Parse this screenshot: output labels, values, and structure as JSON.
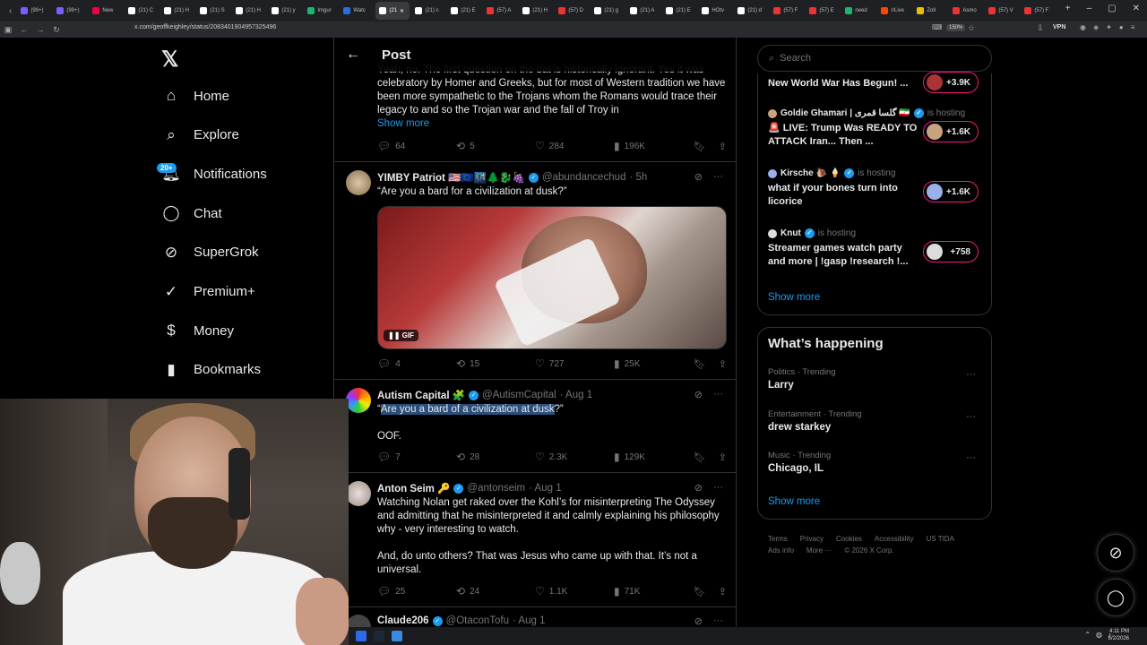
{
  "browser": {
    "tabs": [
      {
        "label": "(99+)",
        "color": "#7b5cff"
      },
      {
        "label": "(99+)",
        "color": "#7b5cff"
      },
      {
        "label": "New",
        "color": "#e04"
      },
      {
        "label": "(21) C",
        "color": "#fff"
      },
      {
        "label": "(21) H",
        "color": "#fff"
      },
      {
        "label": "(21) S",
        "color": "#fff"
      },
      {
        "label": "(21) H",
        "color": "#fff"
      },
      {
        "label": "(21) y",
        "color": "#fff"
      },
      {
        "label": "Imgur",
        "color": "#1bb76e"
      },
      {
        "label": "Watc",
        "color": "#2e6ae6"
      },
      {
        "label": "(21",
        "color": "#fff",
        "active": true
      },
      {
        "label": "(21) c",
        "color": "#fff"
      },
      {
        "label": "(21) E",
        "color": "#fff"
      },
      {
        "label": "(57) A",
        "color": "#e33"
      },
      {
        "label": "(21) H",
        "color": "#fff"
      },
      {
        "label": "(57) D",
        "color": "#e33"
      },
      {
        "label": "(21) g",
        "color": "#fff"
      },
      {
        "label": "(21) A",
        "color": "#fff"
      },
      {
        "label": "(21) E",
        "color": "#fff"
      },
      {
        "label": "HOtv",
        "color": "#fff"
      },
      {
        "label": "(21) d",
        "color": "#fff"
      },
      {
        "label": "(57) F",
        "color": "#e33"
      },
      {
        "label": "(57) E",
        "color": "#e33"
      },
      {
        "label": "need",
        "color": "#1bb76e"
      },
      {
        "label": "r/Live",
        "color": "#ff4500"
      },
      {
        "label": "Zoll",
        "color": "#e9c000"
      },
      {
        "label": "Asmo",
        "color": "#e33"
      },
      {
        "label": "(57) V",
        "color": "#e33"
      },
      {
        "label": "(57) F",
        "color": "#e33"
      }
    ],
    "url": "x.com/geoffkeighley/status/2083401904957325496",
    "zoom": "150%",
    "vpn": "VPN"
  },
  "sidebar": {
    "items": [
      {
        "label": "Home",
        "icon": "home-icon"
      },
      {
        "label": "Explore",
        "icon": "search-icon"
      },
      {
        "label": "Notifications",
        "icon": "bell-icon"
      },
      {
        "label": "Chat",
        "icon": "chat-icon"
      },
      {
        "label": "SuperGrok",
        "icon": "grok-icon"
      },
      {
        "label": "Premium+",
        "icon": "premium-icon"
      },
      {
        "label": "Money",
        "icon": "money-icon"
      },
      {
        "label": "Bookmarks",
        "icon": "bookmark-icon"
      }
    ],
    "notif_badge": "20+"
  },
  "header": {
    "title": "Post"
  },
  "tweets": [
    {
      "text_top": "Yeah, no. The first question on the bat is historically ignorant. Yes it was celebratory by Homer and Greeks, but for most of Western tradition we have been more sympathetic to the Trojans whom the Romans would trace their legacy to and so the Trojan war and the fall of Troy in",
      "show_more": "Show more",
      "replies": "64",
      "reposts": "5",
      "likes": "284",
      "views": "196K"
    },
    {
      "name": "YIMBY Patriot 🇺🇸🇪🇺🌃🌲🐉🍇",
      "handle": "@abundancechud",
      "time": "· 5h",
      "text": "“Are you a bard for a civilization at dusk?”",
      "gif_label": "GIF",
      "replies": "4",
      "reposts": "15",
      "likes": "727",
      "views": "25K"
    },
    {
      "name": "Autism Capital 🧩",
      "handle": "@AutismCapital",
      "time": "· Aug 1",
      "quote_open": "“",
      "quote_highlight": "Are you a bard of a civilization at dusk",
      "quote_close": "?”",
      "text2": "OOF.",
      "replies": "7",
      "reposts": "28",
      "likes": "2.3K",
      "views": "129K"
    },
    {
      "name": "Anton Seim 🔑",
      "handle": "@antonseim",
      "time": "· Aug 1",
      "text": "Watching Nolan get raked over the Kohl’s for misinterpreting The Odyssey and admitting that he misinterpreted it and calmly explaining his philosophy why - very interesting to watch.",
      "text2": "And, do unto others? That was Jesus who came up with that. It’s not a universal.",
      "replies": "25",
      "reposts": "24",
      "likes": "1.1K",
      "views": "71K"
    },
    {
      "name": "Claude206",
      "handle": "@OtaconTofu",
      "time": "· Aug 1"
    }
  ],
  "right": {
    "search_placeholder": "Search",
    "spaces": [
      {
        "host": "",
        "hosting": "",
        "title": "New World War Has Begun! ...",
        "count": "+3.9K",
        "avatar_color": "#a33"
      },
      {
        "host": "Goldie Ghamari | گلسا قمری 🇮🇷",
        "hosting": "is hosting",
        "title": "🚨 LIVE: Trump Was READY TO ATTACK Iran... Then ...",
        "count": "+1.6K",
        "avatar_color": "#c9a27f"
      },
      {
        "host": "Kirsche 🐌 🍦",
        "hosting": "is hosting",
        "title": "what if your bones turn into licorice",
        "count": "+1.6K",
        "avatar_color": "#9ab0e8"
      },
      {
        "host": "Knut",
        "hosting": "is hosting",
        "title": "Streamer games watch party and more  | !gasp !research !...",
        "count": "+758",
        "avatar_color": "#dcdcdc"
      }
    ],
    "show_more_spaces": "Show more",
    "whats_happening": "What’s happening",
    "trends": [
      {
        "meta": "Politics · Trending",
        "name": "Larry"
      },
      {
        "meta": "Entertainment · Trending",
        "name": "drew starkey"
      },
      {
        "meta": "Music · Trending",
        "name": "Chicago, IL"
      }
    ],
    "show_more_trends": "Show more",
    "footer": [
      "Terms",
      "Privacy",
      "Cookies",
      "Accessibility",
      "US TIDA",
      "Ads info",
      "More ···",
      "© 2026 X Corp."
    ]
  },
  "taskbar": {
    "time": "4:11 PM",
    "date": "8/2/2026"
  },
  "colors": {
    "accent": "#1d9bf0",
    "live": "#f91880",
    "bg": "#000000",
    "border": "#2f3336",
    "muted": "#71767b"
  }
}
